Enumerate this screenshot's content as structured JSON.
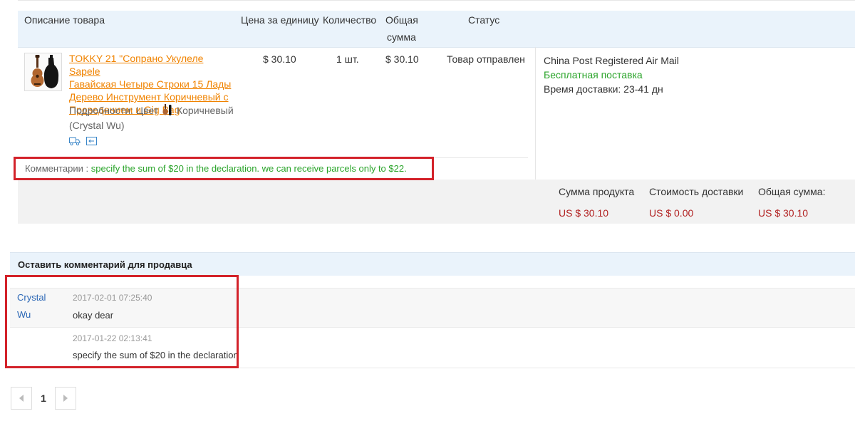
{
  "table": {
    "headers": {
      "description": "Описание товара",
      "unit_price": "Цена за единицу",
      "quantity": "Количество",
      "total_line1": "Общая",
      "total_line2": "сумма",
      "status": "Статус"
    },
    "item": {
      "title_lines": [
        "TOKKY 21 \"Сопрано Укулеле Sapele",
        "Гавайская Четыре Строки 15 Лады",
        "Дерево Инструмент Коричневый с",
        "Проведением и Gig Bag"
      ],
      "details_prefix": "Подробности: Цвет",
      "details_color": "Коричневый",
      "seller": "(Crystal Wu)",
      "unit_price": "$ 30.10",
      "quantity": "1 шт.",
      "total": "$ 30.10",
      "status": "Товар отправлен"
    },
    "shipping": {
      "method": "China Post Registered Air Mail",
      "free": "Бесплатная поставка",
      "delivery_time": "Время доставки: 23-41 дн"
    },
    "comment": {
      "label": "Комментарии :",
      "text": "specify the sum of $20 in the declaration. we can receive parcels only to $22."
    },
    "summary": {
      "product_sum_label": "Сумма продукта",
      "product_sum": "US $ 30.10",
      "shipping_cost_label": "Стоимость доставки",
      "shipping_cost": "US $ 0.00",
      "total_label": "Общая сумма:",
      "total": "US $ 30.10"
    }
  },
  "leave_comment": {
    "title": "Оставить комментарий для продавца",
    "author_line1": "Crystal",
    "author_line2": "Wu",
    "messages": [
      {
        "timestamp": "2017-02-01 07:25:40",
        "text": "okay dear"
      },
      {
        "timestamp": "2017-01-22 02:13:41",
        "text": "specify the sum of $20 in the declaration"
      }
    ]
  },
  "pagination": {
    "current_page": "1"
  },
  "colors": {
    "link_orange": "#f08300",
    "free_green": "#2aa42a",
    "price_red": "#b22222",
    "highlight_red": "#d3222a",
    "header_blue": "#eaf3fb",
    "author_blue": "#2a66b5"
  }
}
